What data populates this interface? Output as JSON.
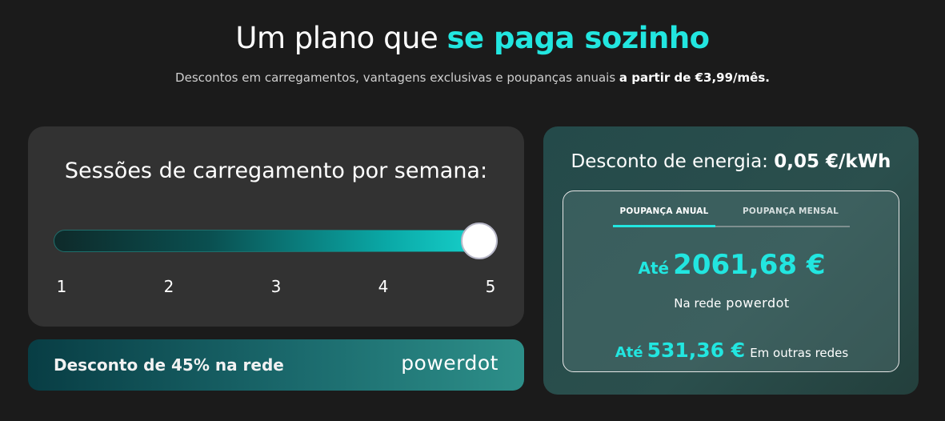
{
  "header": {
    "title_plain": "Um plano que ",
    "title_highlight": "se paga sozinho",
    "subtitle_plain": "Descontos em carregamentos, vantagens exclusivas e poupanças anuais ",
    "subtitle_bold": "a partir de €3,99/mês."
  },
  "sessions": {
    "heading": "Sessões de carregamento por semana:",
    "slider_value": 5,
    "slider_min": 1,
    "slider_max": 5,
    "ticks": [
      "1",
      "2",
      "3",
      "4",
      "5"
    ]
  },
  "promo": {
    "text": "Desconto de 45% na rede",
    "logo_text": "powerdot"
  },
  "savings": {
    "heading_plain": "Desconto de energia: ",
    "heading_bold": "0,05 €/kWh",
    "tabs": [
      {
        "label": "POUPANÇA ANUAL",
        "active": true
      },
      {
        "label": "POUPANÇA MENSAL",
        "active": false
      }
    ],
    "network": {
      "prefix": "Até",
      "amount": "2061,68 €",
      "label": "Na rede",
      "logo_text": "powerdot"
    },
    "other": {
      "prefix": "Até",
      "amount": "531,36 €",
      "label": "Em outras redes"
    }
  },
  "colors": {
    "accent": "#22e6e0",
    "background": "#1b1b1b",
    "card": "#323232"
  }
}
